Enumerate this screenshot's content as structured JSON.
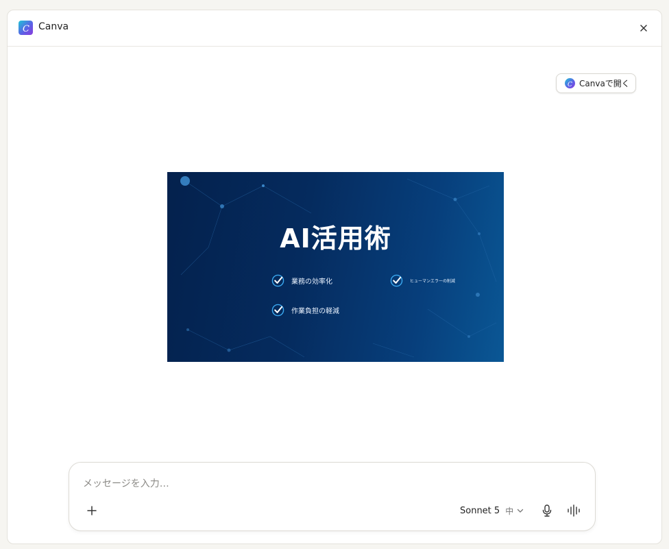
{
  "header": {
    "app_icon": "canva-logo-icon",
    "title": "Canva",
    "close_icon": "close-icon"
  },
  "open_button": {
    "label": "Canvaで開く",
    "icon": "canva-logo-icon"
  },
  "slide": {
    "title": "AI活用術",
    "items": [
      {
        "label": "業務の効率化",
        "icon": "checkmark-icon"
      },
      {
        "label": "ヒューマンエラーの削減",
        "icon": "checkmark-icon"
      },
      {
        "label": "作業負担の軽減",
        "icon": "checkmark-icon"
      }
    ],
    "colors": {
      "background": "#052b5e",
      "accent": "#3aa8f0"
    }
  },
  "composer": {
    "placeholder": "メッセージを入力…",
    "value": "",
    "add_icon": "plus-icon",
    "model_name": "Sonnet 5",
    "model_level": "中",
    "dropdown_icon": "chevron-down-icon",
    "mic_icon": "microphone-icon",
    "voice_icon": "voice-waveform-icon"
  }
}
